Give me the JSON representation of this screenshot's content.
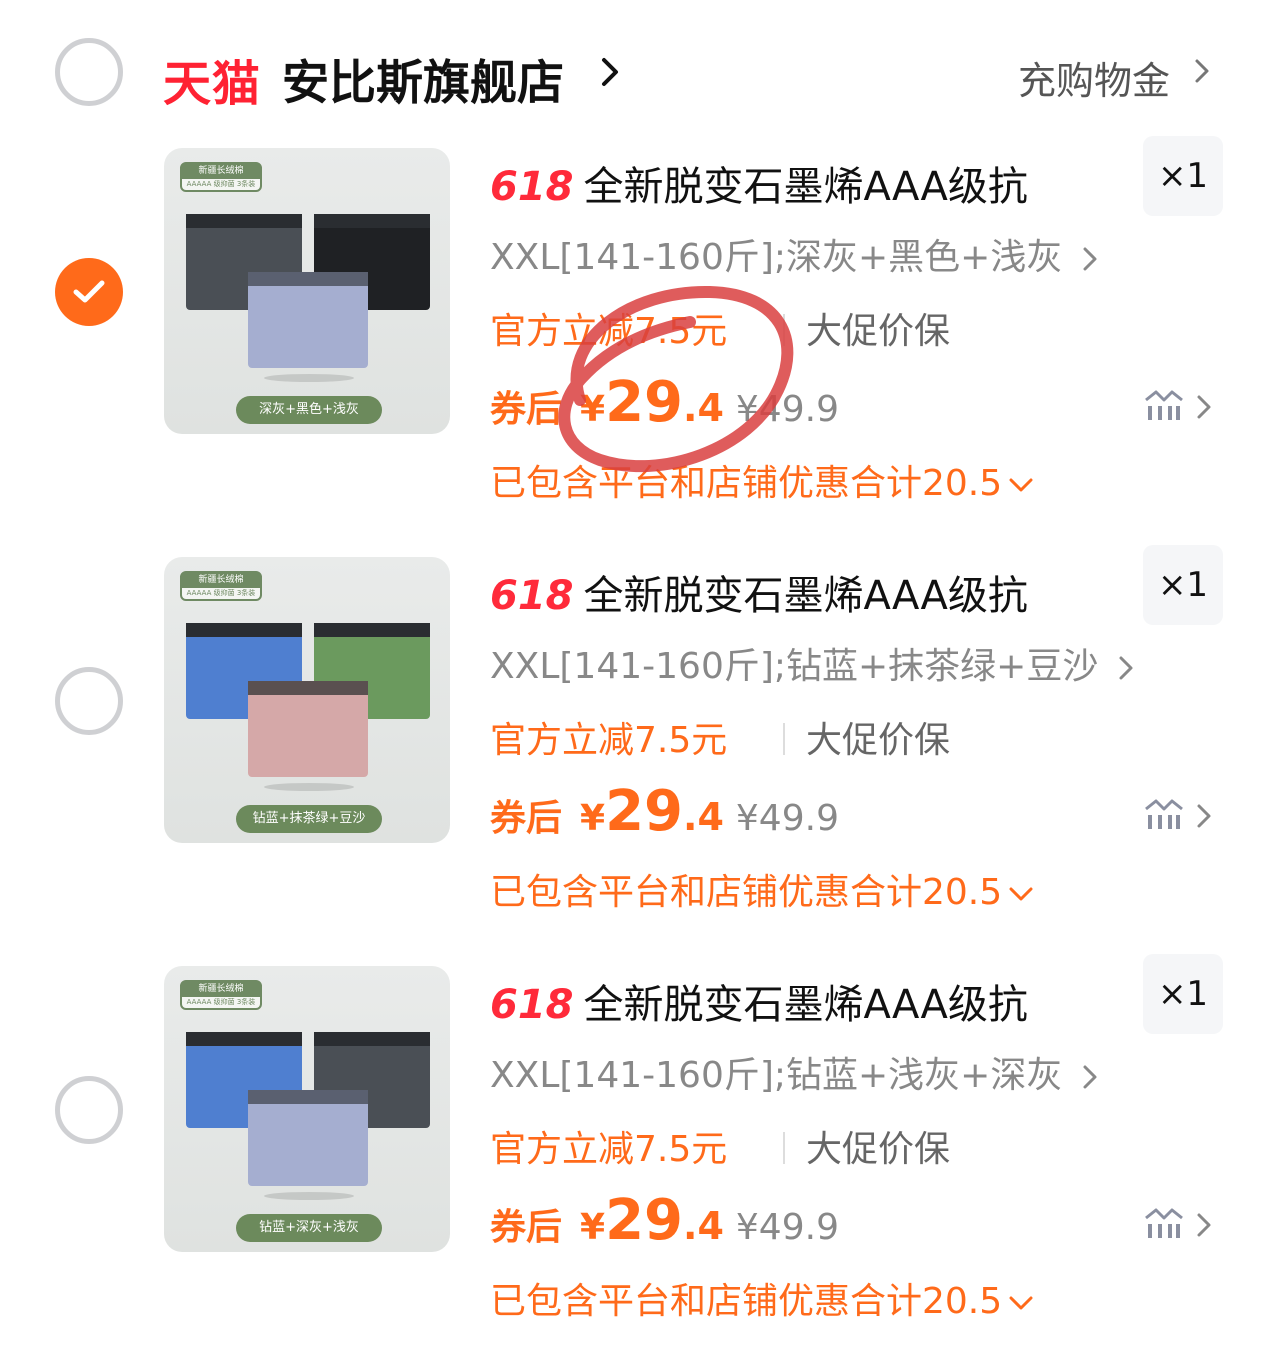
{
  "store": {
    "tmall": "天猫",
    "name": "安比斯旗舰店",
    "charge_label": "充购物金"
  },
  "colors": {
    "accent": "#ff6a1a",
    "tmall_red": "#ff2233"
  },
  "items": [
    {
      "checked": true,
      "tag_618": "618",
      "title": "全新脱变石墨烯AAA级抗",
      "qty": "×1",
      "sku": "XXL[141-160斤];深灰+黑色+浅灰",
      "promo": "官方立减7.5元",
      "guarantee": "大促价保",
      "after_label": "券后",
      "yen": "¥",
      "price_int": "29",
      "price_dec": ".4",
      "orig_price": "¥49.9",
      "discount": "已包含平台和店铺优惠合计20.5",
      "thumb_tag": "深灰+黑色+浅灰",
      "badge_top": "新疆长绒棉",
      "badge_bottom": "AAAAA 级抑菌  3条装"
    },
    {
      "checked": false,
      "tag_618": "618",
      "title": "全新脱变石墨烯AAA级抗",
      "qty": "×1",
      "sku": "XXL[141-160斤];钻蓝+抹茶绿+豆沙",
      "promo": "官方立减7.5元",
      "guarantee": "大促价保",
      "after_label": "券后",
      "yen": "¥",
      "price_int": "29",
      "price_dec": ".4",
      "orig_price": "¥49.9",
      "discount": "已包含平台和店铺优惠合计20.5",
      "thumb_tag": "钻蓝+抹茶绿+豆沙",
      "badge_top": "新疆长绒棉",
      "badge_bottom": "AAAAA 级抑菌  3条装"
    },
    {
      "checked": false,
      "tag_618": "618",
      "title": "全新脱变石墨烯AAA级抗",
      "qty": "×1",
      "sku": "XXL[141-160斤];钻蓝+浅灰+深灰",
      "promo": "官方立减7.5元",
      "guarantee": "大促价保",
      "after_label": "券后",
      "yen": "¥",
      "price_int": "29",
      "price_dec": ".4",
      "orig_price": "¥49.9",
      "discount": "已包含平台和店铺优惠合计20.5",
      "thumb_tag": "钻蓝+深灰+浅灰",
      "badge_top": "新疆长绒棉",
      "badge_bottom": "AAAAA 级抑菌  3条装"
    }
  ]
}
